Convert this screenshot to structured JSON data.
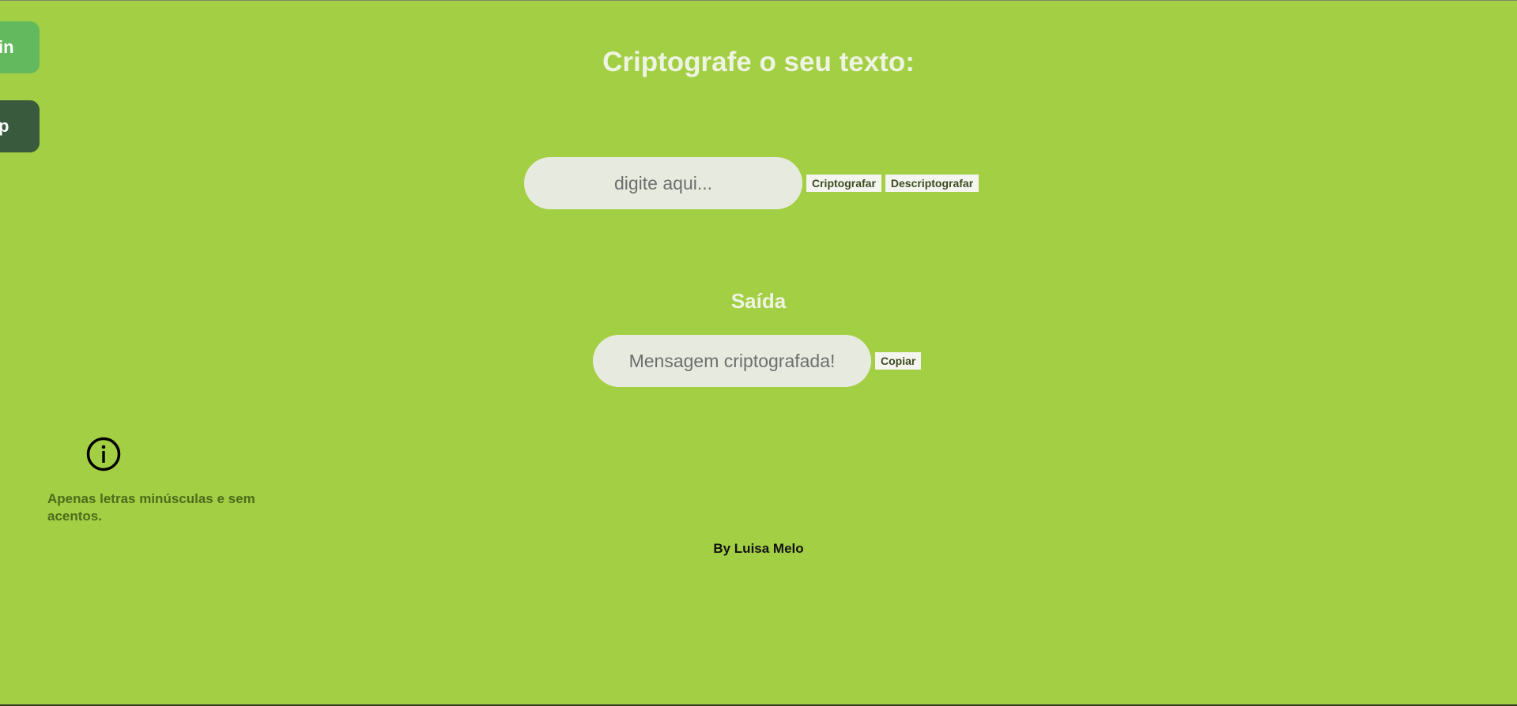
{
  "sidebar": {
    "linkedin_label": "in",
    "github_label": "p"
  },
  "header": {
    "title": "Criptografe o seu texto:"
  },
  "encrypt": {
    "input_placeholder": "digite aqui...",
    "encrypt_label": "Criptografar",
    "decrypt_label": "Descriptografar"
  },
  "output": {
    "title": "Saída",
    "placeholder": "Mensagem criptografada!",
    "copy_label": "Copiar"
  },
  "info": {
    "icon": "info-circle-icon",
    "text": "Apenas letras minúsculas e sem acentos."
  },
  "footer": {
    "credit": "By Luisa Melo"
  },
  "colors": {
    "background": "#a3cf44",
    "linkedin_tab": "#63b95e",
    "github_tab": "#3a5a3e",
    "input_bg": "#e7ebdf"
  }
}
